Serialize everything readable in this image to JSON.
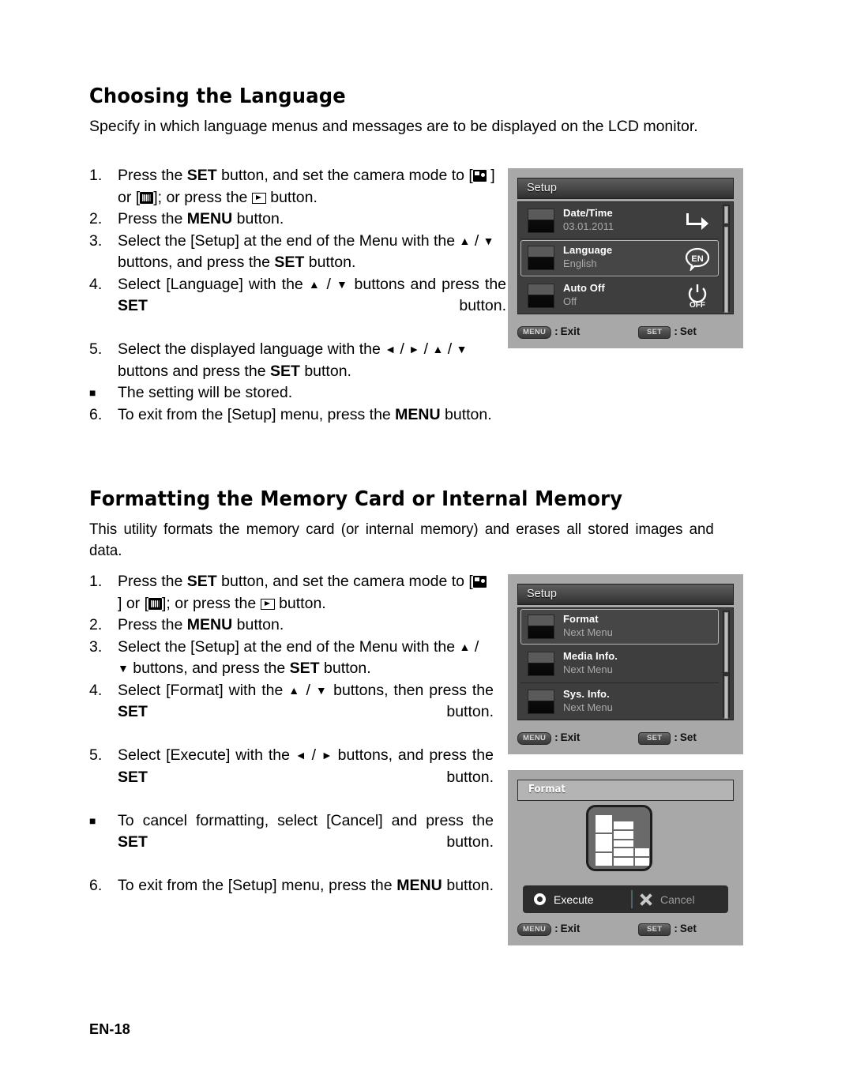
{
  "sections": [
    {
      "heading": "Choosing the Language",
      "intro": "Specify in which language menus and messages are to be displayed on the LCD monitor.",
      "steps": [
        {
          "num": "1.",
          "parts": [
            {
              "t": "Press the "
            },
            {
              "t": "SET",
              "b": true
            },
            {
              "t": " button, and set the camera mode to ["
            },
            {
              "icon": "photo-mode-icon"
            },
            {
              "t": " ] or ["
            },
            {
              "icon": "movie-mode-icon"
            },
            {
              "t": "]; or press the "
            },
            {
              "icon": "playback-icon"
            },
            {
              "t": " button."
            }
          ]
        },
        {
          "num": "2.",
          "parts": [
            {
              "t": "Press the "
            },
            {
              "t": "MENU",
              "b": true
            },
            {
              "t": " button."
            }
          ]
        },
        {
          "num": "3.",
          "parts": [
            {
              "t": "Select the [Setup] at the end of the Menu with the "
            },
            {
              "t": "▲",
              "arrow": true
            },
            {
              "t": " / "
            },
            {
              "t": "▼",
              "arrow": true
            },
            {
              "t": " buttons, and press the "
            },
            {
              "t": "SET",
              "b": true
            },
            {
              "t": " button."
            }
          ]
        },
        {
          "num": "4.",
          "justify": true,
          "parts": [
            {
              "t": "Select [Language] with the "
            },
            {
              "t": "▲",
              "arrow": true
            },
            {
              "t": " / "
            },
            {
              "t": "▼",
              "arrow": true
            },
            {
              "t": " buttons and press the "
            },
            {
              "t": "SET",
              "b": true
            },
            {
              "t": " button."
            }
          ]
        },
        {
          "num": "5.",
          "parts": [
            {
              "t": "Select the displayed language with the "
            },
            {
              "t": "◄",
              "arrow": true
            },
            {
              "t": " / "
            },
            {
              "t": "►",
              "arrow": true
            },
            {
              "t": " / "
            },
            {
              "t": "▲",
              "arrow": true
            },
            {
              "t": " / "
            },
            {
              "t": "▼",
              "arrow": true
            },
            {
              "t": " buttons and press the "
            },
            {
              "t": "SET",
              "b": true
            },
            {
              "t": " button."
            }
          ],
          "sub": [
            {
              "bullet": "■",
              "parts": [
                {
                  "t": "The setting will be stored."
                }
              ]
            }
          ]
        },
        {
          "num": "6.",
          "parts": [
            {
              "t": "To exit from the [Setup] menu, press the "
            },
            {
              "t": "MENU",
              "b": true
            },
            {
              "t": " button."
            }
          ]
        }
      ]
    },
    {
      "heading": "Formatting the Memory Card or Internal Memory",
      "intro": "This utility formats the memory card (or internal memory) and erases all stored images and data.",
      "steps": [
        {
          "num": "1.",
          "parts": [
            {
              "t": "Press the "
            },
            {
              "t": "SET",
              "b": true
            },
            {
              "t": " button, and set the camera mode to ["
            },
            {
              "icon": "photo-mode-icon"
            },
            {
              "t": " ] or ["
            },
            {
              "icon": "movie-mode-icon"
            },
            {
              "t": "]; or press the "
            },
            {
              "icon": "playback-icon"
            },
            {
              "t": " button."
            }
          ]
        },
        {
          "num": "2.",
          "parts": [
            {
              "t": "Press the "
            },
            {
              "t": "MENU",
              "b": true
            },
            {
              "t": " button."
            }
          ]
        },
        {
          "num": "3.",
          "parts": [
            {
              "t": "Select the [Setup] at the end of the Menu with the "
            },
            {
              "t": "▲",
              "arrow": true
            },
            {
              "t": " / "
            },
            {
              "t": "▼",
              "arrow": true
            },
            {
              "t": " buttons, and press the "
            },
            {
              "t": "SET",
              "b": true
            },
            {
              "t": " button."
            }
          ]
        },
        {
          "num": "4.",
          "justify": true,
          "parts": [
            {
              "t": "Select [Format] with the "
            },
            {
              "t": "▲",
              "arrow": true
            },
            {
              "t": " / "
            },
            {
              "t": "▼",
              "arrow": true
            },
            {
              "t": " buttons, then press the "
            },
            {
              "t": "SET",
              "b": true
            },
            {
              "t": " button."
            }
          ]
        },
        {
          "num": "5.",
          "justify": true,
          "parts": [
            {
              "t": "Select [Execute] with the "
            },
            {
              "t": "◄",
              "arrow": true
            },
            {
              "t": " / "
            },
            {
              "t": "►",
              "arrow": true
            },
            {
              "t": " buttons, and press the "
            },
            {
              "t": "SET",
              "b": true
            },
            {
              "t": " button."
            }
          ],
          "sub": [
            {
              "bullet": "■",
              "justify": true,
              "parts": [
                {
                  "t": "To cancel formatting, select [Cancel] and press the "
                },
                {
                  "t": "SET",
                  "b": true
                },
                {
                  "t": " button."
                }
              ]
            }
          ]
        },
        {
          "num": "6.",
          "justify": true,
          "parts": [
            {
              "t": "To exit from the [Setup] menu, press the "
            },
            {
              "t": "MENU",
              "b": true
            },
            {
              "t": " button."
            }
          ]
        }
      ]
    }
  ],
  "screens": {
    "setup_language": {
      "title": "Setup",
      "rows": [
        {
          "label": "Date/Time",
          "value": "03.01.2011",
          "icon": "arrow-right-enter-icon",
          "selected": false
        },
        {
          "label": "Language",
          "value": "English",
          "icon": "language-en-bubble-icon",
          "selected": true
        },
        {
          "label": "Auto Off",
          "value": "Off",
          "icon": "power-off-icon",
          "selected": false
        }
      ],
      "footer": {
        "exit_key": "MENU",
        "exit_label": "Exit",
        "set_key": "SET",
        "set_label": "Set"
      }
    },
    "setup_format": {
      "title": "Setup",
      "rows": [
        {
          "label": "Format",
          "value": "Next Menu",
          "selected": true
        },
        {
          "label": "Media Info.",
          "value": "Next Menu",
          "selected": false
        },
        {
          "label": "Sys. Info.",
          "value": "Next Menu",
          "selected": false
        }
      ],
      "footer": {
        "exit_key": "MENU",
        "exit_label": "Exit",
        "set_key": "SET",
        "set_label": "Set"
      }
    },
    "format_confirm": {
      "title": "Format",
      "execute_label": "Execute",
      "cancel_label": "Cancel",
      "footer": {
        "exit_key": "MENU",
        "exit_label": "Exit",
        "set_key": "SET",
        "set_label": "Set"
      }
    }
  },
  "footer": {
    "page_number": "EN-18"
  },
  "colors": {
    "screen_frame": "#a8a8a8",
    "screen_list_bg": "#3e3e3e",
    "screen_title_bg": "#4a4a4a",
    "label_text": "#ffffff",
    "value_text": "#a9a9a9",
    "selected_border": "#b8b8b8",
    "format_dialog_title_bg": "#b4b4b4",
    "button_bar_bg": "#2c2c2c",
    "cancel_text": "#9a9a9a"
  }
}
